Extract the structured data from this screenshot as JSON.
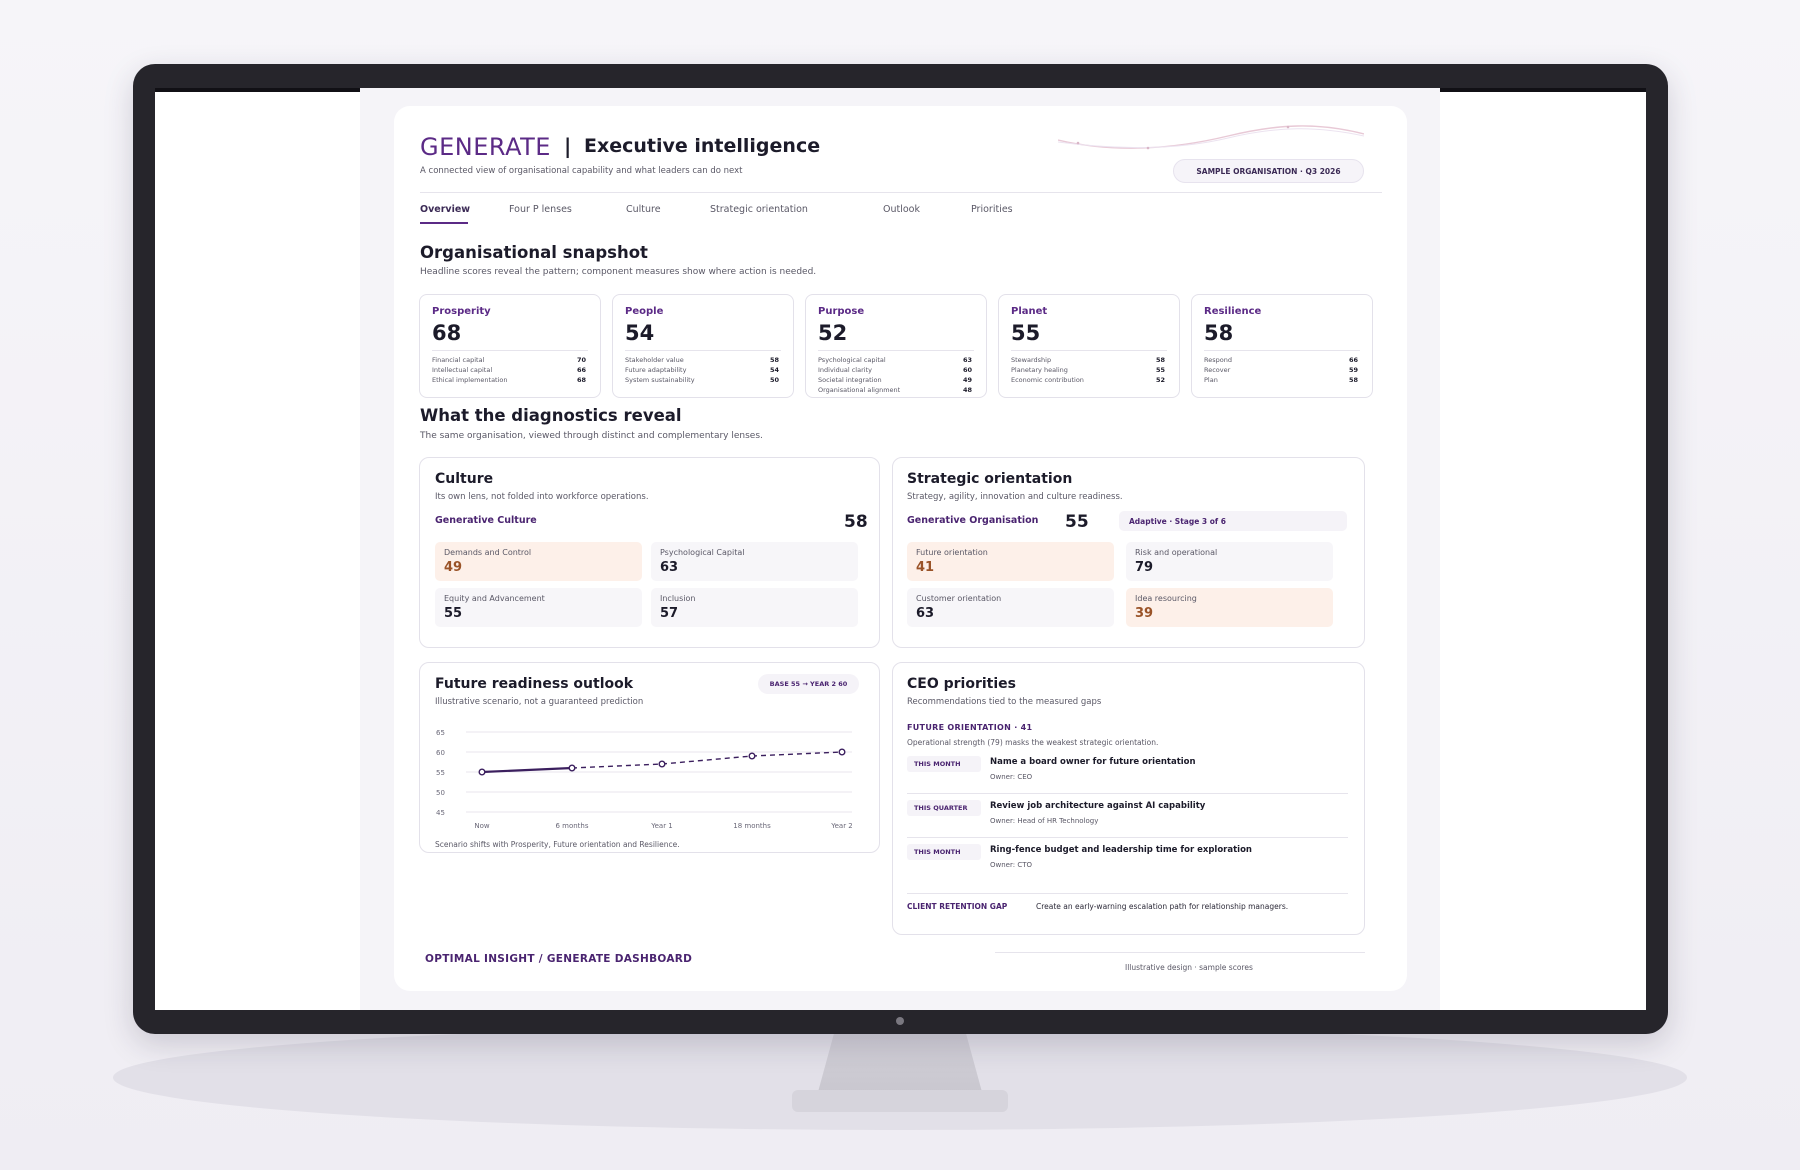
{
  "header": {
    "brand": "GENERATE",
    "separator": "|",
    "title": "Executive intelligence",
    "subtitle": "A connected view of organisational capability and what leaders can do next",
    "org_pill": "SAMPLE ORGANISATION  ·  Q3 2026"
  },
  "tabs": [
    {
      "label": "Overview",
      "active": true
    },
    {
      "label": "Four P lenses",
      "active": false
    },
    {
      "label": "Culture",
      "active": false
    },
    {
      "label": "Strategic orientation",
      "active": false
    },
    {
      "label": "Outlook",
      "active": false
    },
    {
      "label": "Priorities",
      "active": false
    }
  ],
  "snapshot": {
    "title": "Organisational snapshot",
    "subtitle": "Headline scores reveal the pattern; component measures show where action is needed.",
    "cards": [
      {
        "name": "Prosperity",
        "score": "68",
        "rows": [
          {
            "label": "Financial capital",
            "value": "70"
          },
          {
            "label": "Intellectual capital",
            "value": "66"
          },
          {
            "label": "Ethical implementation",
            "value": "68"
          }
        ]
      },
      {
        "name": "People",
        "score": "54",
        "rows": [
          {
            "label": "Stakeholder value",
            "value": "58"
          },
          {
            "label": "Future adaptability",
            "value": "54"
          },
          {
            "label": "System sustainability",
            "value": "50"
          }
        ]
      },
      {
        "name": "Purpose",
        "score": "52",
        "rows": [
          {
            "label": "Psychological capital",
            "value": "63"
          },
          {
            "label": "Individual clarity",
            "value": "60"
          },
          {
            "label": "Societal integration",
            "value": "49"
          },
          {
            "label": "Organisational alignment",
            "value": "48"
          }
        ]
      },
      {
        "name": "Planet",
        "score": "55",
        "rows": [
          {
            "label": "Stewardship",
            "value": "58"
          },
          {
            "label": "Planetary healing",
            "value": "55"
          },
          {
            "label": "Economic contribution",
            "value": "52"
          }
        ]
      },
      {
        "name": "Resilience",
        "score": "58",
        "rows": [
          {
            "label": "Respond",
            "value": "66"
          },
          {
            "label": "Recover",
            "value": "59"
          },
          {
            "label": "Plan",
            "value": "58"
          }
        ]
      }
    ]
  },
  "diagnostics": {
    "title": "What the diagnostics reveal",
    "subtitle": "The same organisation, viewed through distinct and complementary lenses."
  },
  "culture": {
    "title": "Culture",
    "subtitle": "Its own lens, not folded into workforce operations.",
    "lens_label": "Generative Culture",
    "lens_score": "58",
    "metrics": [
      {
        "label": "Demands and Control",
        "value": "49",
        "warn": true
      },
      {
        "label": "Psychological Capital",
        "value": "63",
        "warn": false
      },
      {
        "label": "Equity and Advancement",
        "value": "55",
        "warn": false
      },
      {
        "label": "Inclusion",
        "value": "57",
        "warn": false
      }
    ]
  },
  "strategic": {
    "title": "Strategic orientation",
    "subtitle": "Strategy, agility, innovation and culture readiness.",
    "lens_label": "Generative Organisation",
    "lens_score": "55",
    "stage": "Adaptive  ·  Stage 3 of 6",
    "metrics": [
      {
        "label": "Future orientation",
        "value": "41",
        "warn": true
      },
      {
        "label": "Risk and operational",
        "value": "79",
        "warn": false
      },
      {
        "label": "Customer orientation",
        "value": "63",
        "warn": false
      },
      {
        "label": "Idea resourcing",
        "value": "39",
        "warn": true
      }
    ]
  },
  "outlook": {
    "title": "Future readiness outlook",
    "subtitle": "Illustrative scenario, not a guaranteed prediction",
    "pill": "BASE 55  →  YEAR 2 60",
    "footnote": "Scenario shifts with Prosperity, Future orientation and Resilience.",
    "colors": {
      "line": "#3b1f5e",
      "grid": "#e8e6ee"
    }
  },
  "chart_data": {
    "type": "line",
    "categories": [
      "Now",
      "6 months",
      "Year 1",
      "18 months",
      "Year 2"
    ],
    "values": [
      55,
      56,
      57,
      59,
      60
    ],
    "solid_until_index": 1,
    "yticks": [
      65,
      60,
      55,
      50,
      45
    ],
    "ylim": [
      45,
      65
    ],
    "grid": true
  },
  "priorities": {
    "title": "CEO priorities",
    "subtitle": "Recommendations tied to the measured gaps",
    "focus": "FUTURE ORIENTATION  ·  41",
    "focus_note": "Operational strength (79) masks the weakest strategic orientation.",
    "items": [
      {
        "tag": "THIS MONTH",
        "title": "Name a board owner for future orientation",
        "owner": "Owner: CEO"
      },
      {
        "tag": "THIS QUARTER",
        "title": "Review job architecture against AI capability",
        "owner": "Owner: Head of HR Technology"
      },
      {
        "tag": "THIS MONTH",
        "title": "Ring-fence budget and leadership time for exploration",
        "owner": "Owner: CTO"
      }
    ],
    "gap_label": "CLIENT RETENTION GAP",
    "gap_text": "Create an early-warning escalation path for relationship managers."
  },
  "footer": {
    "brand": "OPTIMAL INSIGHT / GENERATE DASHBOARD",
    "note": "Illustrative design · sample scores"
  },
  "colors": {
    "accent": "#5b2a86",
    "warn_bg": "#fdf0e9",
    "warn_text": "#9a5328"
  }
}
